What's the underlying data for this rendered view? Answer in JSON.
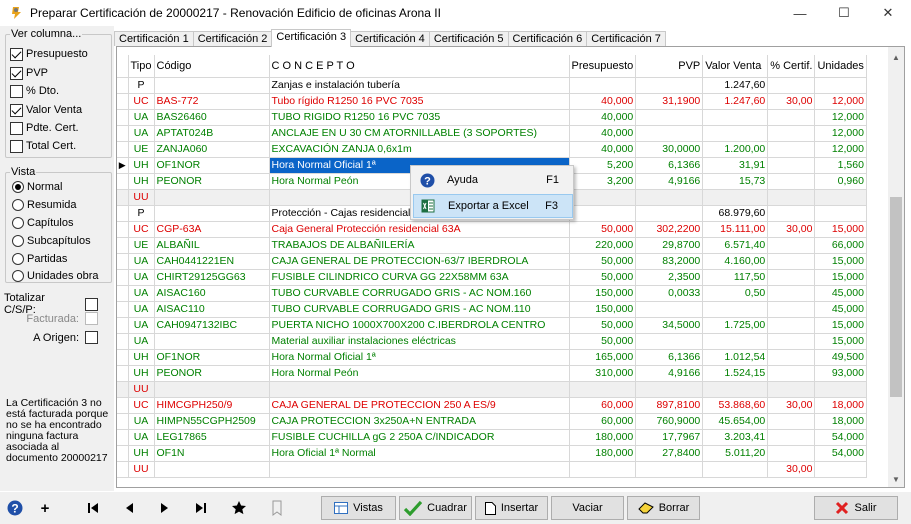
{
  "window": {
    "title": "Preparar Certificación de 20000217 - Renovación Edificio de oficinas Arona II",
    "minimize": "—",
    "maximize": "☐",
    "close": "✕"
  },
  "sidebar": {
    "ver_columna_title": "Ver columna...",
    "columns": [
      {
        "label": "Presupuesto",
        "checked": true
      },
      {
        "label": "PVP",
        "checked": true
      },
      {
        "label": "% Dto.",
        "checked": false
      },
      {
        "label": "Valor Venta",
        "checked": true
      },
      {
        "label": "Pdte. Cert.",
        "checked": false
      },
      {
        "label": "Total Cert.",
        "checked": false
      }
    ],
    "vista_title": "Vista",
    "vista_options": [
      {
        "label": "Normal",
        "selected": true
      },
      {
        "label": "Resumida",
        "selected": false
      },
      {
        "label": "Capítulos",
        "selected": false
      },
      {
        "label": "Subcapítulos",
        "selected": false
      },
      {
        "label": "Partidas",
        "selected": false
      },
      {
        "label": "Unidades obra",
        "selected": false
      }
    ],
    "totalizar_label": "Totalizar C/S/P:",
    "facturada_label": "Facturada:",
    "a_origen_label": "A Origen:",
    "note": "La Certificación 3 no está facturada porque no se ha encontrado ninguna factura asociada al documento 20000217"
  },
  "tabs": [
    "Certificación 1",
    "Certificación 2",
    "Certificación 3",
    "Certificación 4",
    "Certificación 5",
    "Certificación 6",
    "Certificación 7"
  ],
  "active_tab": 2,
  "grid": {
    "headers": [
      "Tipo",
      "Código",
      "C O N C E P T O",
      "Presupuesto",
      "PVP",
      "Valor Venta",
      "% Certif.",
      "Unidades"
    ],
    "rows": [
      {
        "tipo": "P",
        "codigo": "",
        "concepto": "Zanjas e instalación tubería",
        "presupuesto": "",
        "pvp": "",
        "valor": "1.247,60",
        "certif": "",
        "unidades": "",
        "color": "black",
        "gray": false,
        "selected": false
      },
      {
        "tipo": "UC",
        "codigo": "BAS-772",
        "concepto": "Tubo rígido R1250 16 PVC 7035",
        "presupuesto": "40,000",
        "pvp": "31,1900",
        "valor": "1.247,60",
        "certif": "30,00",
        "unidades": "12,000",
        "color": "red",
        "gray": false,
        "selected": false
      },
      {
        "tipo": "UA",
        "codigo": "BAS26460",
        "concepto": "TUBO RIGIDO R1250 16 PVC 7035",
        "presupuesto": "40,000",
        "pvp": "",
        "valor": "",
        "certif": "",
        "unidades": "12,000",
        "color": "green",
        "gray": false,
        "selected": false
      },
      {
        "tipo": "UA",
        "codigo": "APTAT024B",
        "concepto": "ANCLAJE EN U 30 CM ATORNILLABLE (3 SOPORTES)",
        "presupuesto": "40,000",
        "pvp": "",
        "valor": "",
        "certif": "",
        "unidades": "12,000",
        "color": "green",
        "gray": false,
        "selected": false
      },
      {
        "tipo": "UE",
        "codigo": "ZANJA060",
        "concepto": "EXCAVACIÓN ZANJA 0,6x1m",
        "presupuesto": "40,000",
        "pvp": "30,0000",
        "valor": "1.200,00",
        "certif": "",
        "unidades": "12,000",
        "color": "green",
        "gray": false,
        "selected": false
      },
      {
        "tipo": "UH",
        "codigo": "OF1NOR",
        "concepto": "Hora Normal Oficial 1ª",
        "presupuesto": "5,200",
        "pvp": "6,1366",
        "valor": "31,91",
        "certif": "",
        "unidades": "1,560",
        "color": "green",
        "gray": false,
        "selected": true
      },
      {
        "tipo": "UH",
        "codigo": "PEONOR",
        "concepto": "Hora Normal Peón",
        "presupuesto": "3,200",
        "pvp": "4,9166",
        "valor": "15,73",
        "certif": "",
        "unidades": "0,960",
        "color": "green",
        "gray": false,
        "selected": false
      },
      {
        "tipo": "UU",
        "codigo": "",
        "concepto": "",
        "presupuesto": "",
        "pvp": "",
        "valor": "",
        "certif": "",
        "unidades": "",
        "color": "red",
        "gray": true,
        "selected": false
      },
      {
        "tipo": "P",
        "codigo": "",
        "concepto": "Protección - Cajas residenciales",
        "presupuesto": "",
        "pvp": "",
        "valor": "68.979,60",
        "certif": "",
        "unidades": "",
        "color": "black",
        "gray": false,
        "selected": false
      },
      {
        "tipo": "UC",
        "codigo": "CGP-63A",
        "concepto": "Caja General Protección residencial 63A",
        "presupuesto": "50,000",
        "pvp": "302,2200",
        "valor": "15.111,00",
        "certif": "30,00",
        "unidades": "15,000",
        "color": "red",
        "gray": false,
        "selected": false
      },
      {
        "tipo": "UE",
        "codigo": "ALBAÑIL",
        "concepto": "TRABAJOS DE ALBAÑILERÍA",
        "presupuesto": "220,000",
        "pvp": "29,8700",
        "valor": "6.571,40",
        "certif": "",
        "unidades": "66,000",
        "color": "green",
        "gray": false,
        "selected": false
      },
      {
        "tipo": "UA",
        "codigo": "CAH0441221EN",
        "concepto": "CAJA GENERAL DE PROTECCION-63/7 IBERDROLA",
        "presupuesto": "50,000",
        "pvp": "83,2000",
        "valor": "4.160,00",
        "certif": "",
        "unidades": "15,000",
        "color": "green",
        "gray": false,
        "selected": false
      },
      {
        "tipo": "UA",
        "codigo": "CHIRT29125GG63",
        "concepto": "FUSIBLE CILINDRICO CURVA GG 22X58MM 63A",
        "presupuesto": "50,000",
        "pvp": "2,3500",
        "valor": "117,50",
        "certif": "",
        "unidades": "15,000",
        "color": "green",
        "gray": false,
        "selected": false
      },
      {
        "tipo": "UA",
        "codigo": "AISAC160",
        "concepto": "TUBO CURVABLE CORRUGADO GRIS - AC NOM.160",
        "presupuesto": "150,000",
        "pvp": "0,0033",
        "valor": "0,50",
        "certif": "",
        "unidades": "45,000",
        "color": "green",
        "gray": false,
        "selected": false
      },
      {
        "tipo": "UA",
        "codigo": "AISAC110",
        "concepto": "TUBO CURVABLE CORRUGADO GRIS - AC NOM.110",
        "presupuesto": "150,000",
        "pvp": "",
        "valor": "",
        "certif": "",
        "unidades": "45,000",
        "color": "green",
        "gray": false,
        "selected": false
      },
      {
        "tipo": "UA",
        "codigo": "CAH0947132IBC",
        "concepto": "PUERTA NICHO 1000X700X200 C.IBERDROLA CENTRO",
        "presupuesto": "50,000",
        "pvp": "34,5000",
        "valor": "1.725,00",
        "certif": "",
        "unidades": "15,000",
        "color": "green",
        "gray": false,
        "selected": false
      },
      {
        "tipo": "UA",
        "codigo": "",
        "concepto": "Material auxiliar instalaciones eléctricas",
        "presupuesto": "50,000",
        "pvp": "",
        "valor": "",
        "certif": "",
        "unidades": "15,000",
        "color": "green",
        "gray": false,
        "selected": false
      },
      {
        "tipo": "UH",
        "codigo": "OF1NOR",
        "concepto": "Hora Normal Oficial 1ª",
        "presupuesto": "165,000",
        "pvp": "6,1366",
        "valor": "1.012,54",
        "certif": "",
        "unidades": "49,500",
        "color": "green",
        "gray": false,
        "selected": false
      },
      {
        "tipo": "UH",
        "codigo": "PEONOR",
        "concepto": "Hora Normal Peón",
        "presupuesto": "310,000",
        "pvp": "4,9166",
        "valor": "1.524,15",
        "certif": "",
        "unidades": "93,000",
        "color": "green",
        "gray": false,
        "selected": false
      },
      {
        "tipo": "UU",
        "codigo": "",
        "concepto": "",
        "presupuesto": "",
        "pvp": "",
        "valor": "",
        "certif": "",
        "unidades": "",
        "color": "red",
        "gray": true,
        "selected": false
      },
      {
        "tipo": "UC",
        "codigo": "HIMCGPH250/9",
        "concepto": "CAJA GENERAL DE PROTECCION 250 A ES/9",
        "presupuesto": "60,000",
        "pvp": "897,8100",
        "valor": "53.868,60",
        "certif": "30,00",
        "unidades": "18,000",
        "color": "red",
        "gray": false,
        "selected": false
      },
      {
        "tipo": "UA",
        "codigo": "HIMPN55CGPH2509",
        "concepto": "CAJA PROTECCION 3x250A+N ENTRADA",
        "presupuesto": "60,000",
        "pvp": "760,9000",
        "valor": "45.654,00",
        "certif": "",
        "unidades": "18,000",
        "color": "green",
        "gray": false,
        "selected": false
      },
      {
        "tipo": "UA",
        "codigo": "LEG17865",
        "concepto": "FUSIBLE CUCHILLA gG 2 250A C/INDICADOR",
        "presupuesto": "180,000",
        "pvp": "17,7967",
        "valor": "3.203,41",
        "certif": "",
        "unidades": "54,000",
        "color": "green",
        "gray": false,
        "selected": false
      },
      {
        "tipo": "UH",
        "codigo": "OF1N",
        "concepto": "Hora Oficial 1ª Normal",
        "presupuesto": "180,000",
        "pvp": "27,8400",
        "valor": "5.011,20",
        "certif": "",
        "unidades": "54,000",
        "color": "green",
        "gray": false,
        "selected": false
      },
      {
        "tipo": "UU",
        "codigo": "",
        "concepto": "",
        "presupuesto": "",
        "pvp": "",
        "valor": "",
        "certif": "30,00",
        "unidades": "",
        "color": "red",
        "gray": false,
        "selected": false
      }
    ],
    "current_row_marker": "▶"
  },
  "context_menu": {
    "items": [
      {
        "label": "Ayuda",
        "shortcut": "F1",
        "icon": "help-icon"
      },
      {
        "label": "Exportar a Excel",
        "shortcut": "F3",
        "icon": "excel-icon"
      }
    ]
  },
  "toolbar": {
    "vistas": "Vistas",
    "cuadrar": "Cuadrar",
    "insertar": "Insertar",
    "vaciar": "Vaciar",
    "borrar": "Borrar",
    "salir": "Salir",
    "plus": "+"
  },
  "colors": {
    "red": "#dd0000",
    "green": "#008000",
    "selection": "#0a64c8",
    "accent": "#0078d7"
  }
}
